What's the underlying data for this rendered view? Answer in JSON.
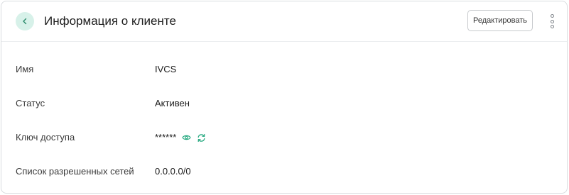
{
  "header": {
    "title": "Информация о клиенте",
    "back_icon": "chevron-left-icon",
    "edit_label": "Редактировать",
    "more_icon": "more-vertical-icon"
  },
  "fields": [
    {
      "label": "Имя",
      "value": "IVCS"
    },
    {
      "label": "Статус",
      "value": "Активен"
    },
    {
      "label": "Ключ доступа",
      "value": "******",
      "icons": [
        "eye-icon",
        "refresh-icon"
      ]
    },
    {
      "label": "Список разрешенных сетей",
      "value": "0.0.0.0/0"
    }
  ],
  "colors": {
    "accent": "#2bab83",
    "accent_bg": "#d7f1e9",
    "border": "#d9dcdf"
  }
}
